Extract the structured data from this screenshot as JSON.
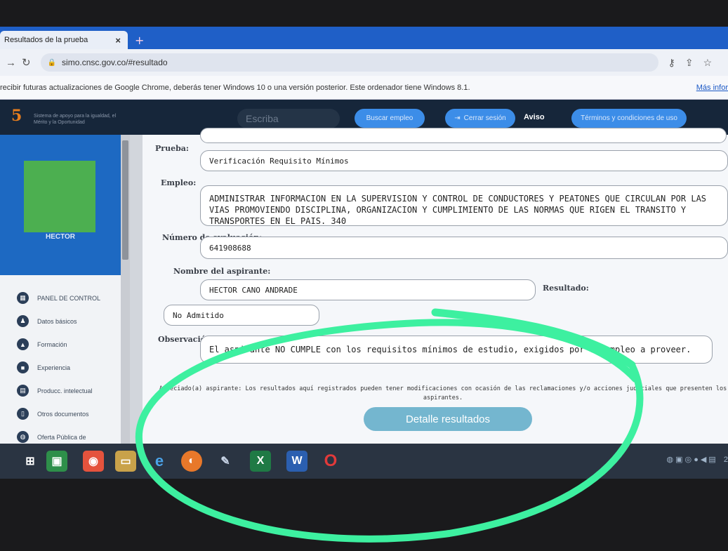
{
  "browser": {
    "tab_title": "Resultados de la prueba",
    "tab_close": "×",
    "new_tab": "+",
    "url": "simo.cnsc.gov.co/#resultado",
    "infobar_text": "recibir futuras actualizaciones de Google Chrome, deberás tener Windows 10 o una versión posterior. Este ordenador tiene Windows 8.1.",
    "infobar_link": "Más infor"
  },
  "site_header": {
    "logo_mark": "5",
    "logo_text": "Sistema de apoyo para la igualdad, el Mérito y la Oportunidad",
    "search_placeholder": "Escriba",
    "buscar_empleo": "Buscar empleo",
    "cerrar_sesion": "Cerrar sesión",
    "aviso": "Aviso",
    "terminos": "Términos y condiciones de uso"
  },
  "sidebar": {
    "user_name": "HECTOR",
    "items": [
      {
        "label": "PANEL DE CONTROL",
        "icon": "grid-icon"
      },
      {
        "label": "Datos básicos",
        "icon": "users-icon"
      },
      {
        "label": "Formación",
        "icon": "graduation-cap-icon"
      },
      {
        "label": "Experiencia",
        "icon": "briefcase-icon"
      },
      {
        "label": "Producc. intelectual",
        "icon": "book-icon"
      },
      {
        "label": "Otros documentos",
        "icon": "document-icon"
      },
      {
        "label": "Oferta Pública de",
        "icon": "globe-icon"
      }
    ]
  },
  "result": {
    "prueba_label": "Prueba:",
    "prueba_value": "Verificación Requisito Mínimos",
    "empleo_label": "Empleo:",
    "empleo_value": "ADMINISTRAR INFORMACION EN LA SUPERVISION Y CONTROL DE CONDUCTORES Y PEATONES QUE CIRCULAN POR LAS VIAS PROMOVIENDO DISCIPLINA, ORGANIZACION Y CUMPLIMIENTO DE LAS NORMAS QUE RIGEN EL TRANSITO Y TRANSPORTES EN EL PAIS. 340",
    "numero_label": "Número de evaluación:",
    "numero_value": "641908688",
    "nombre_label": "Nombre del aspirante:",
    "nombre_value": "HECTOR CANO ANDRADE",
    "resultado_label": "Resultado:",
    "resultado_value": "No Admitido",
    "observacion_label": "Observación:",
    "observacion_value": "El aspirante NO CUMPLE con los requisitos mínimos de estudio, exigidos por el empleo a proveer.",
    "notice": "Apreciado(a) aspirante: Los resultados aquí registrados pueden tener modificaciones con ocasión de las reclamaciones y/o acciones judiciales que presenten los aspirantes.",
    "detail_button": "Detalle resultados"
  },
  "taskbar": {
    "icons": [
      "windows-start-icon",
      "store-icon",
      "chrome-icon",
      "folder-icon",
      "ie-icon",
      "firefox-icon",
      "paint-icon",
      "excel-icon",
      "word-icon",
      "opera-icon"
    ],
    "excel_letter": "X",
    "word_letter": "W",
    "tray_text": "2"
  },
  "colors": {
    "browser_blue": "#1f5fc7",
    "header_navy": "#16263a",
    "pill_blue": "#3c8de8",
    "sidebar_blue": "#1d69c2",
    "avatar_green": "#4caf50",
    "annotation_green": "#3df0a0"
  }
}
